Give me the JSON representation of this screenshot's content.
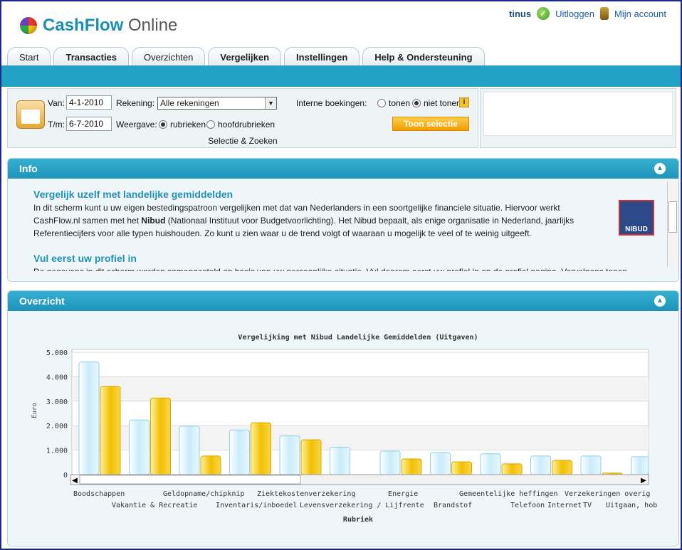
{
  "app": {
    "logo_bold": "CashFlow",
    "logo_rest": " Online"
  },
  "user": {
    "name": "tinus",
    "logout": "Uitloggen",
    "account": "Mijn account"
  },
  "tabs": [
    {
      "label": "Start"
    },
    {
      "label": "Transacties"
    },
    {
      "label": "Overzichten"
    },
    {
      "label": "Vergelijken"
    },
    {
      "label": "Instellingen"
    },
    {
      "label": "Help & Ondersteuning"
    }
  ],
  "filter": {
    "van_label": "Van:",
    "van_value": "4-1-2010",
    "tm_label": "T/m:",
    "tm_value": "6-7-2010",
    "rekening_label": "Rekening:",
    "rekening_value": "Alle rekeningen",
    "weergave_label": "Weergave:",
    "opt_rubrieken": "rubrieken",
    "opt_hoofdrubrieken": "hoofdrubrieken",
    "interne_label": "Interne boekingen:",
    "opt_tonen": "tonen",
    "opt_niet_tonen": "niet tonen",
    "button": "Toon selectie",
    "caption": "Selectie & Zoeken"
  },
  "info": {
    "title": "Info",
    "h1": "Vergelijk uzelf met landelijke gemiddelden",
    "p1a": "In dit scherm kunt u uw eigen bestedingspatroon vergelijken met dat van Nederlanders in een soortgelijke financiele situatie. Hiervoor werkt CashFlow.nl samen met het ",
    "p1b": "Nibud",
    "p1c": " (Nationaal Instituut voor Budgetvoorlichting). Het Nibud bepaalt, als enige organisatie in Nederland, jaarlijks Referentiecijfers voor alle typen huishouden. Zo kunt u zien waar u de trend volgt of waaraan u mogelijk te veel of te weinig uitgeeft.",
    "h2": "Vul eerst uw profiel in",
    "p2": "De gegevens in dit scherm worden samengesteld op basis van uw persoonlijke situatie. Vul daarom eerst uw profiel in op de profiel pagina. Vervolgens tonen",
    "nibud_logo": "NIBUD"
  },
  "overzicht": {
    "title": "Overzicht"
  },
  "chart_data": {
    "type": "bar",
    "title": "Vergelijking met Nibud Landelijke Gemiddelden (Uitgaven)",
    "xlabel": "Rubriek",
    "ylabel": "Euro",
    "ylim": [
      0,
      5000
    ],
    "yticks": [
      "0",
      "1.000",
      "2.000",
      "3.000",
      "4.000",
      "5.000"
    ],
    "categories": [
      "Boodschappen",
      "Vakantie & Recreatie",
      "Geldopname/chipknip",
      "Inventaris/inboedel",
      "Ziektekostenverzekering",
      "Levensverzekering / Lijfrente",
      "Energie",
      "Brandstof",
      "Gemeentelijke heffingen",
      "Telefoon",
      "Internet",
      "TV",
      "Verzekeringen overig",
      "Uitgaan, hob"
    ],
    "series": [
      {
        "values": [
          4600,
          2230,
          1980,
          1820,
          1580,
          1120,
          960,
          900,
          850,
          760,
          760,
          730,
          660,
          0
        ],
        "color": "#d9f1fb"
      },
      {
        "values": [
          3600,
          3130,
          760,
          2120,
          1420,
          0,
          640,
          520,
          440,
          580,
          60,
          0,
          0,
          0
        ],
        "color": "#f6c500"
      }
    ],
    "label_rows": [
      [
        "Boodschappen",
        "Geldopname/chipknip",
        "Ziektekostenverzekering",
        "Energie",
        "Gemeentelijke heffingen",
        "Verzekeringen overig"
      ],
      [
        "Vakantie & Recreatie",
        "Inventaris/inboedel",
        "Levensverzekering / Lijfrente",
        "Brandstof",
        "Telefoon",
        "Internet",
        "TV",
        "Uitgaan, hob"
      ]
    ]
  }
}
